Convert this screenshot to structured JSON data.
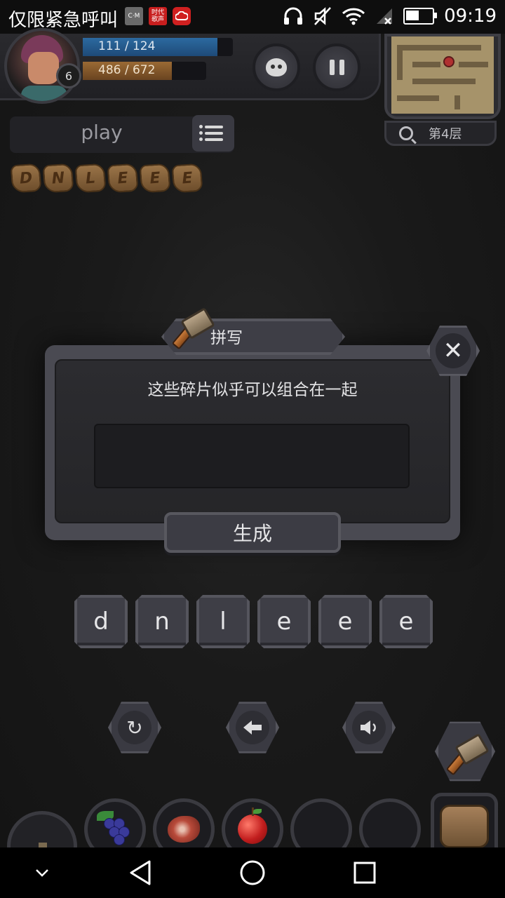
{
  "status_bar": {
    "left_text": "仅限紧急呼叫",
    "notif_icons": [
      {
        "name": "cmcc-icon",
        "label": "C·M",
        "color": "#6a6a6a"
      },
      {
        "name": "shidai-gesheng-icon",
        "label": "时代歌声",
        "color": "#c81e1e"
      },
      {
        "name": "cloud-app-icon",
        "label": "",
        "color": "#d02020"
      }
    ],
    "time": "09:19",
    "battery_level": 0.55
  },
  "hud": {
    "level": "6",
    "hp_text": "111 / 124",
    "hp_fraction": 0.895,
    "xp_text": "486 / 672",
    "xp_fraction": 0.723
  },
  "minimap": {
    "floor_label": "第4层"
  },
  "word_panel": {
    "word": "play"
  },
  "fragments": [
    "D",
    "N",
    "L",
    "E",
    "E",
    "E"
  ],
  "dialog": {
    "title": "拼写",
    "message": "这些碎片似乎可以组合在一起",
    "input_value": "",
    "generate_label": "生成",
    "close_glyph": "✕"
  },
  "letter_tiles": [
    "d",
    "n",
    "l",
    "e",
    "e",
    "e"
  ],
  "controls": {
    "reset_glyph": "↻",
    "back_glyph": "🡄",
    "sound_glyph": "🔈"
  },
  "item_bar": [
    {
      "name": "grape-item"
    },
    {
      "name": "meat-item"
    },
    {
      "name": "apple-item"
    },
    {
      "name": "empty-slot"
    },
    {
      "name": "empty-slot"
    },
    {
      "name": "backpack-item"
    }
  ]
}
